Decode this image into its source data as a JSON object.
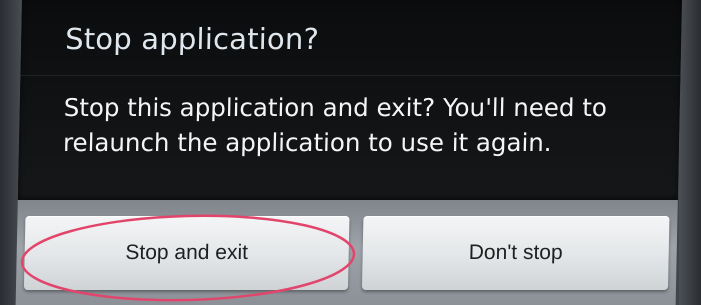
{
  "dialog": {
    "title": "Stop application?",
    "message": "Stop this application and exit? You'll need to relaunch the application to use it again."
  },
  "buttons": {
    "stop_and_exit": "Stop and exit",
    "dont_stop": "Don't stop"
  },
  "annotation": {
    "color": "#e2456c",
    "target": "stop-and-exit-button"
  },
  "colors": {
    "dialog_background": "#0b0c0e",
    "title_text": "#dfe7ee",
    "message_text": "#f3f5f7",
    "button_bar": "#9da3a9",
    "button_face": "#e3e6e8"
  }
}
